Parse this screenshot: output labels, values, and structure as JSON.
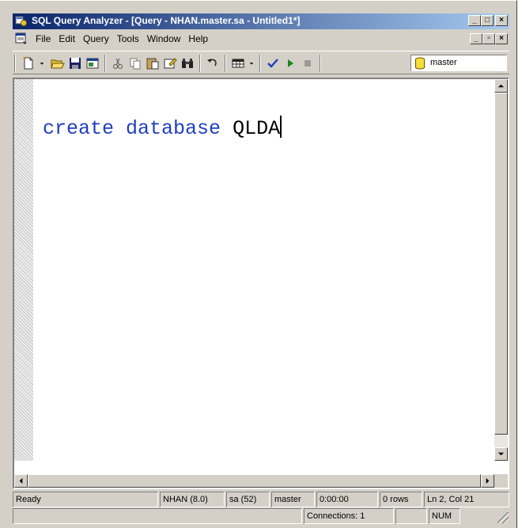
{
  "window": {
    "title": "SQL Query Analyzer - [Query - NHAN.master.sa - Untitled1*]",
    "caption_buttons": [
      "_",
      "□",
      "×"
    ]
  },
  "menubar": {
    "items": [
      "File",
      "Edit",
      "Query",
      "Tools",
      "Window",
      "Help"
    ],
    "mdi_buttons": [
      "_",
      "▫",
      "×"
    ]
  },
  "toolbar": {
    "buttons": [
      "new-query",
      "open",
      "save",
      "load-script",
      "cut",
      "copy",
      "paste",
      "clear-window",
      "find",
      "undo",
      "results-grid",
      "parse",
      "execute",
      "cancel-execution"
    ],
    "database": "master"
  },
  "editor": {
    "keyword_text": "create database",
    "identifier_text": "QLDA"
  },
  "status": {
    "ready": "Ready",
    "server": "NHAN (8.0)",
    "user": "sa (52)",
    "database": "master",
    "elapsed": "0:00:00",
    "rows": "0 rows",
    "position": "Ln 2, Col 21",
    "connections": "Connections: 1",
    "num": "NUM"
  },
  "colors": {
    "keyword": "#1f3ec0",
    "titlebar_start": "#0a246a",
    "titlebar_end": "#a6caf0",
    "chrome": "#d4d0c8"
  }
}
